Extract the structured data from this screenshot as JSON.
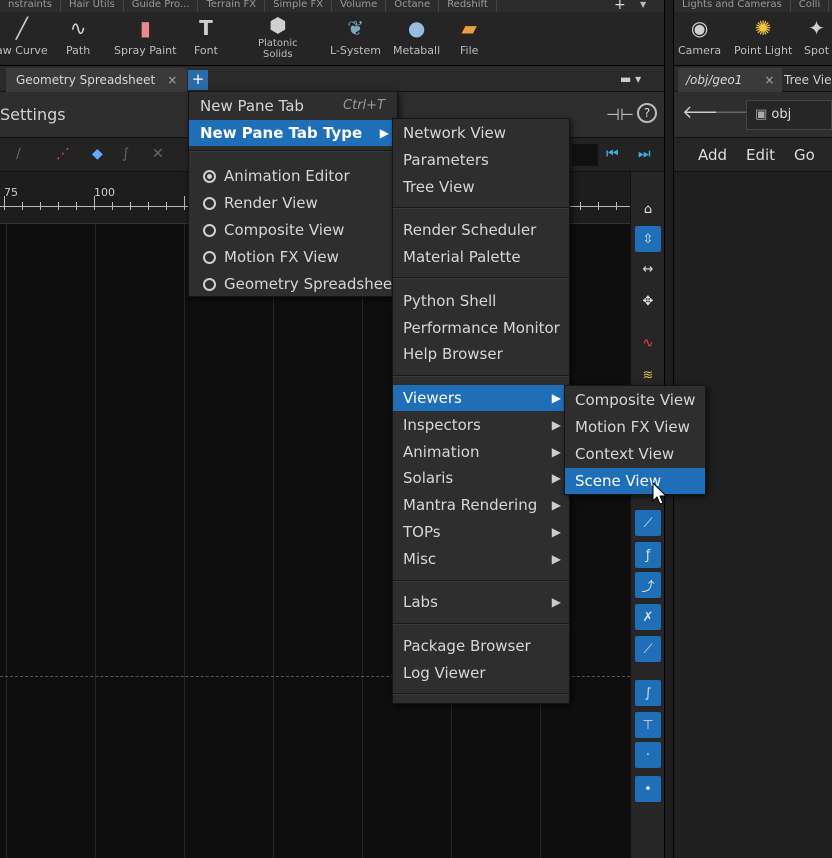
{
  "shelf": {
    "tabs": [
      "nstraints",
      "Hair Utils",
      "Guide Pro...",
      "Terrain FX",
      "Simple FX",
      "Volume",
      "Octane",
      "Redshift"
    ],
    "tools": [
      {
        "label": "aw Curve",
        "icon": "draw-curve-icon"
      },
      {
        "label": "Path",
        "icon": "path-icon"
      },
      {
        "label": "Spray Paint",
        "icon": "spray-paint-icon"
      },
      {
        "label": "Font",
        "icon": "font-icon"
      },
      {
        "label": "Platonic\nSolids",
        "icon": "platonic-solids-icon"
      },
      {
        "label": "L-System",
        "icon": "l-system-icon"
      },
      {
        "label": "Metaball",
        "icon": "metaball-icon"
      },
      {
        "label": "File",
        "icon": "file-icon"
      }
    ],
    "right_tabs": [
      "Lights and Cameras",
      "Colli"
    ],
    "right_tools": [
      {
        "label": "Camera",
        "icon": "camera-icon"
      },
      {
        "label": "Point Light",
        "icon": "point-light-icon"
      },
      {
        "label": "Spot",
        "icon": "spot-light-icon"
      }
    ]
  },
  "pane": {
    "tab_label": "Geometry Spreadsheet",
    "close_glyph": "×",
    "plus_glyph": "+",
    "settings_title": "Settings",
    "help_glyph": "?"
  },
  "right_pane": {
    "path_tab": "/obj/geo1",
    "close_glyph": "×",
    "tree_tab": "Tree Vie",
    "obj_label": "obj",
    "menu": [
      "Add",
      "Edit",
      "Go"
    ]
  },
  "ruler": {
    "labels": [
      "75",
      "100"
    ]
  },
  "menus": {
    "main": {
      "new_pane_tab": "New Pane Tab",
      "new_pane_tab_shortcut": "Ctrl+T",
      "new_pane_tab_type": "New Pane Tab Type",
      "radio_items": [
        {
          "label": "Animation Editor",
          "checked": true
        },
        {
          "label": "Render View",
          "checked": false
        },
        {
          "label": "Composite View",
          "checked": false
        },
        {
          "label": "Motion FX View",
          "checked": false
        },
        {
          "label": "Geometry Spreadsheet",
          "checked": false
        }
      ]
    },
    "types": {
      "groups": [
        [
          "Network View",
          "Parameters",
          "Tree View"
        ],
        [
          "Render Scheduler",
          "Material Palette"
        ],
        [
          "Python Shell",
          "Performance Monitor",
          "Help Browser"
        ],
        [
          "Viewers",
          "Inspectors",
          "Animation",
          "Solaris",
          "Mantra Rendering",
          "TOPs",
          "Misc"
        ],
        [
          "Labs"
        ],
        [
          "Package Browser",
          "Log Viewer"
        ]
      ],
      "submenu_items": [
        "Viewers",
        "Inspectors",
        "Animation",
        "Solaris",
        "Mantra Rendering",
        "TOPs",
        "Misc",
        "Labs"
      ],
      "highlighted": "Viewers"
    },
    "viewers": {
      "items": [
        "Composite View",
        "Motion FX View",
        "Context View",
        "Scene View"
      ],
      "highlighted": "Scene View"
    }
  },
  "colors": {
    "accent": "#1f6fb8",
    "menu_bg": "#2e2e2e",
    "graph_bg": "#0e0e0e"
  }
}
